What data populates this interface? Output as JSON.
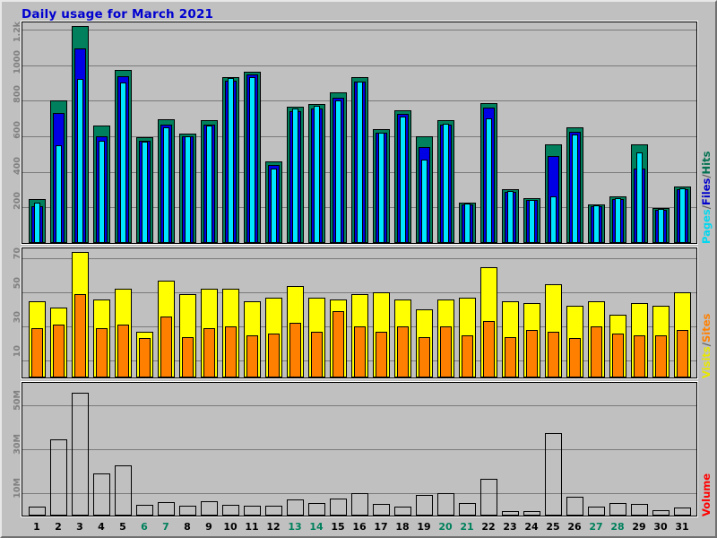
{
  "title": "Daily usage for March 2021",
  "colors": {
    "title": "#0000d0",
    "hits": "#00805c",
    "files": "#0000e6",
    "pages": "#00e6ff",
    "visits": "#ffff00",
    "sites": "#ff8000",
    "volume": "#ff0000",
    "weekend_label": "#00805c",
    "background": "#c0c0c0",
    "gridline": "#7a7a7a"
  },
  "legends": {
    "top": {
      "parts": [
        "Pages",
        "Files",
        "Hits"
      ],
      "separator": "/"
    },
    "middle": {
      "parts": [
        "Visits",
        "Sites"
      ],
      "separator": "/"
    },
    "bottom": {
      "parts": [
        "Volume"
      ],
      "separator": ""
    }
  },
  "xaxis": {
    "days": [
      "1",
      "2",
      "3",
      "4",
      "5",
      "6",
      "7",
      "8",
      "9",
      "10",
      "11",
      "12",
      "13",
      "14",
      "15",
      "16",
      "17",
      "18",
      "19",
      "20",
      "21",
      "22",
      "23",
      "24",
      "25",
      "26",
      "27",
      "28",
      "29",
      "30",
      "31"
    ],
    "weekend_days": [
      "6",
      "7",
      "13",
      "14",
      "20",
      "21",
      "27",
      "28"
    ]
  },
  "chart_data": [
    {
      "type": "bar",
      "id": "hits-files-pages",
      "title": "Daily usage for March 2021",
      "xlabel": "",
      "ylabel": "Pages/Files/Hits",
      "ylim": [
        0,
        1240
      ],
      "grid": true,
      "yticks": [
        200,
        400,
        600,
        800,
        1000,
        1200
      ],
      "ytick_labels": [
        "200",
        "400",
        "600",
        "800",
        "1000",
        "1.2k"
      ],
      "categories": [
        "1",
        "2",
        "3",
        "4",
        "5",
        "6",
        "7",
        "8",
        "9",
        "10",
        "11",
        "12",
        "13",
        "14",
        "15",
        "16",
        "17",
        "18",
        "19",
        "20",
        "21",
        "22",
        "23",
        "24",
        "25",
        "26",
        "27",
        "28",
        "29",
        "30",
        "31"
      ],
      "series": [
        {
          "name": "Hits",
          "color": "#00805c",
          "values": [
            245,
            800,
            1220,
            660,
            975,
            595,
            695,
            615,
            690,
            935,
            965,
            460,
            765,
            780,
            845,
            935,
            640,
            745,
            600,
            690,
            225,
            785,
            300,
            250,
            555,
            650,
            215,
            260,
            555,
            195,
            320
          ]
        },
        {
          "name": "Files",
          "color": "#0000e6",
          "values": [
            205,
            730,
            1095,
            600,
            940,
            575,
            665,
            600,
            665,
            910,
            950,
            440,
            740,
            755,
            815,
            905,
            620,
            725,
            540,
            665,
            215,
            760,
            285,
            240,
            490,
            625,
            205,
            245,
            420,
            185,
            305
          ]
        },
        {
          "name": "Pages",
          "color": "#00e6ff",
          "values": [
            225,
            550,
            920,
            575,
            900,
            570,
            650,
            600,
            660,
            930,
            935,
            420,
            755,
            770,
            800,
            905,
            620,
            710,
            470,
            670,
            220,
            700,
            290,
            240,
            260,
            610,
            210,
            250,
            510,
            190,
            310
          ]
        }
      ]
    },
    {
      "type": "bar",
      "id": "visits-sites",
      "title": "",
      "xlabel": "",
      "ylabel": "Visits/Sites",
      "ylim": [
        0,
        76
      ],
      "grid": true,
      "yticks": [
        10,
        30,
        50,
        70
      ],
      "ytick_labels": [
        "10",
        "30",
        "50",
        "70"
      ],
      "categories": [
        "1",
        "2",
        "3",
        "4",
        "5",
        "6",
        "7",
        "8",
        "9",
        "10",
        "11",
        "12",
        "13",
        "14",
        "15",
        "16",
        "17",
        "18",
        "19",
        "20",
        "21",
        "22",
        "23",
        "24",
        "25",
        "26",
        "27",
        "28",
        "29",
        "30",
        "31"
      ],
      "series": [
        {
          "name": "Visits",
          "color": "#ffff00",
          "values": [
            45,
            41,
            74,
            46,
            52,
            27,
            57,
            49,
            52,
            52,
            45,
            47,
            54,
            47,
            46,
            49,
            50,
            46,
            40,
            46,
            47,
            65,
            45,
            44,
            55,
            42,
            45,
            37,
            44,
            42,
            50
          ]
        },
        {
          "name": "Sites",
          "color": "#ff8000",
          "values": [
            29,
            31,
            49,
            29,
            31,
            23,
            36,
            24,
            29,
            30,
            25,
            26,
            32,
            27,
            39,
            30,
            27,
            30,
            24,
            30,
            25,
            33,
            24,
            28,
            27,
            23,
            30,
            26,
            25,
            25,
            28
          ]
        }
      ]
    },
    {
      "type": "bar",
      "id": "volume",
      "title": "",
      "xlabel": "",
      "ylabel": "Volume",
      "ylim": [
        0,
        60000000
      ],
      "grid": true,
      "yticks": [
        10000000,
        30000000,
        50000000
      ],
      "ytick_labels": [
        "10M",
        "30M",
        "50M"
      ],
      "categories": [
        "1",
        "2",
        "3",
        "4",
        "5",
        "6",
        "7",
        "8",
        "9",
        "10",
        "11",
        "12",
        "13",
        "14",
        "15",
        "16",
        "17",
        "18",
        "19",
        "20",
        "21",
        "22",
        "23",
        "24",
        "25",
        "26",
        "27",
        "28",
        "29",
        "30",
        "31"
      ],
      "series": [
        {
          "name": "Volume",
          "color": "#ff0000",
          "values": [
            4200000,
            34500000,
            55500000,
            19200000,
            22700000,
            5000000,
            6000000,
            4600000,
            6500000,
            4800000,
            4400000,
            4300000,
            7500000,
            5700000,
            7600000,
            10200000,
            5300000,
            4100000,
            9200000,
            10100000,
            5500000,
            16500000,
            2100000,
            2200000,
            37500000,
            8600000,
            4000000,
            5800000,
            5200000,
            2600000,
            3700000
          ]
        }
      ]
    }
  ]
}
